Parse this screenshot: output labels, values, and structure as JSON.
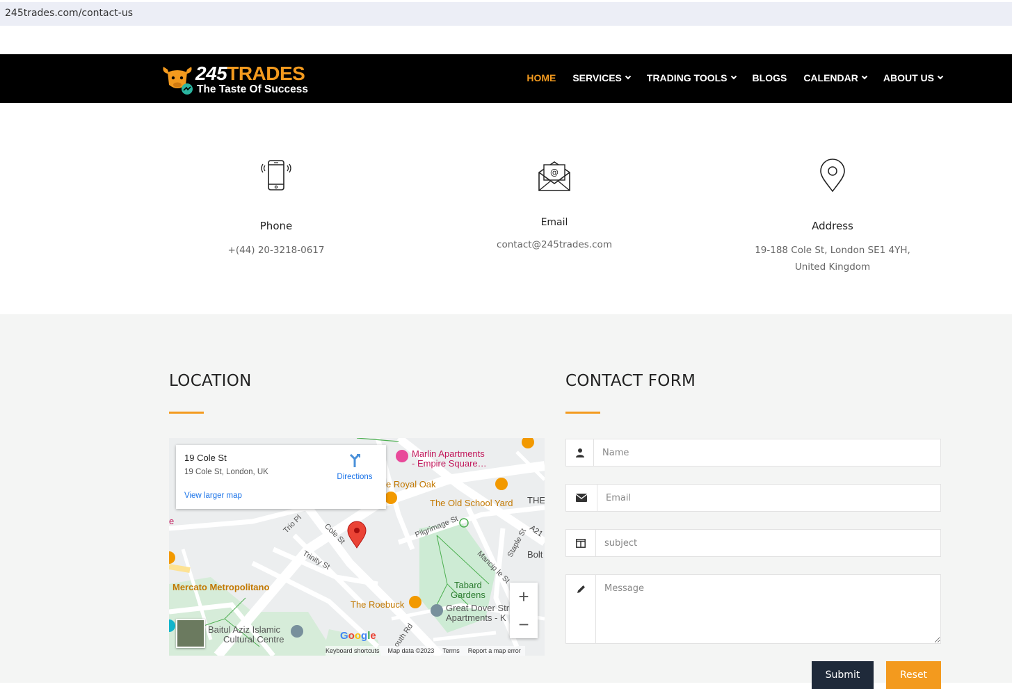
{
  "browser": {
    "url": "245trades.com/contact-us"
  },
  "header": {
    "logo": {
      "number": "245",
      "word": "TRADES",
      "tagline": "The Taste Of Success"
    },
    "nav": [
      {
        "label": "HOME",
        "active": true,
        "dropdown": false
      },
      {
        "label": "SERVICES",
        "active": false,
        "dropdown": true
      },
      {
        "label": "TRADING TOOLS",
        "active": false,
        "dropdown": true
      },
      {
        "label": "BLOGS",
        "active": false,
        "dropdown": false
      },
      {
        "label": "CALENDAR",
        "active": false,
        "dropdown": true
      },
      {
        "label": "ABOUT US",
        "active": false,
        "dropdown": true
      }
    ]
  },
  "contact_info": [
    {
      "icon": "phone-icon",
      "label": "Phone",
      "value": "+(44) 20-3218-0617"
    },
    {
      "icon": "email-icon",
      "label": "Email",
      "value": "contact@245trades.com"
    },
    {
      "icon": "location-pin-icon",
      "label": "Address",
      "value": "19-188 Cole St, London SE1 4YH,",
      "value2": "United Kingdom"
    }
  ],
  "location": {
    "title": "LOCATION",
    "map": {
      "place_name": "19 Cole St",
      "place_address": "19 Cole St, London, UK",
      "directions_label": "Directions",
      "view_larger": "View larger map",
      "labels": {
        "marlin": "Marlin Apartments",
        "marlin2": "- Empire Square…",
        "royal_oak": "e Royal Oak",
        "old_school": "The Old School Yard",
        "the": "THE",
        "pilgrimage": "Pilgrimage St",
        "trio": "Trio Pl",
        "cole": "Cole St",
        "trinity": "Trinity St",
        "staple": "Staple St",
        "a21": "A21",
        "bolt": "Bolt",
        "mancip": "Mancip le St",
        "tabard": "Tabard",
        "gardens": "Gardens",
        "mercato": "Mercato Metropolitano",
        "roebuck": "The Roebuck",
        "great_dover": "Great Dover Str",
        "apartments": "Apartments - K",
        "baitul": "Baitul Aziz Islamic",
        "cultural": "Cultural Centre",
        "south_rd": "outh Rd",
        "e_left": "e"
      },
      "footer": [
        "Keyboard shortcuts",
        "Map data ©2023",
        "Terms",
        "Report a map error"
      ],
      "google": "Google"
    }
  },
  "contact_form": {
    "title": "CONTACT FORM",
    "fields": [
      {
        "name": "name",
        "icon": "user-icon",
        "placeholder": "Name",
        "value": ""
      },
      {
        "name": "email",
        "icon": "envelope-icon",
        "placeholder": "Email",
        "value": ""
      },
      {
        "name": "subject",
        "icon": "columns-icon",
        "placeholder": "subject",
        "value": ""
      },
      {
        "name": "message",
        "icon": "pencil-icon",
        "placeholder": "Message",
        "value": ""
      }
    ],
    "submit_label": "Submit",
    "reset_label": "Reset"
  },
  "colors": {
    "accent": "#f39a1e",
    "header_bg": "#000000",
    "section_bg": "#f4f5f4",
    "submit_bg": "#1f2a3a"
  }
}
